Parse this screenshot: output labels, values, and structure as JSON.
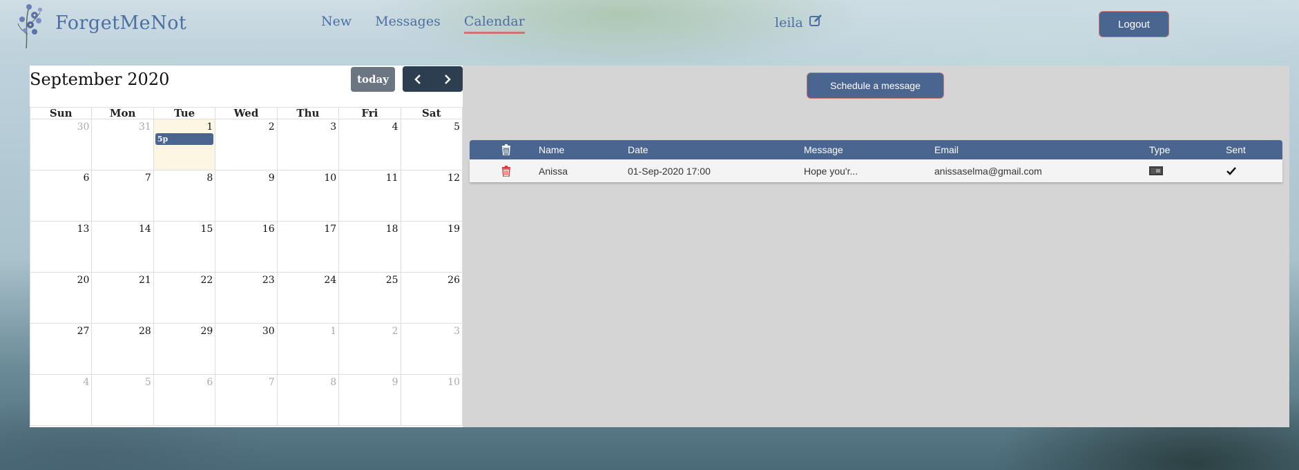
{
  "header": {
    "logo_text": "ForgetMeNot",
    "nav": [
      {
        "label": "New"
      },
      {
        "label": "Messages"
      },
      {
        "label": "Calendar"
      }
    ],
    "user_name": "leila",
    "logout_label": "Logout"
  },
  "calendar": {
    "title": "September 2020",
    "today_label": "today",
    "weekdays": [
      "Sun",
      "Mon",
      "Tue",
      "Wed",
      "Thu",
      "Fri",
      "Sat"
    ],
    "days": [
      "30",
      "31",
      "1",
      "2",
      "3",
      "4",
      "5",
      "6",
      "7",
      "8",
      "9",
      "10",
      "11",
      "12",
      "13",
      "14",
      "15",
      "16",
      "17",
      "18",
      "19",
      "20",
      "21",
      "22",
      "23",
      "24",
      "25",
      "26",
      "27",
      "28",
      "29",
      "30",
      "1",
      "2",
      "3",
      "4",
      "5",
      "6",
      "7",
      "8",
      "9",
      "10"
    ],
    "event_label": "5p"
  },
  "schedule": {
    "button_label": "Schedule a message"
  },
  "table": {
    "headers": {
      "name": "Name",
      "date": "Date",
      "message": "Message",
      "email": "Email",
      "type": "Type",
      "sent": "Sent"
    },
    "rows": [
      {
        "name": "Anissa",
        "date": "01-Sep-2020 17:00",
        "message": "Hope you'r...",
        "email": "anissaselma@gmail.com"
      }
    ]
  },
  "colors": {
    "primary": "#4a6590",
    "accent": "#c8786b",
    "delete_icon": "#e03a3a"
  },
  "icons": [
    "flower-logo-icon",
    "edit-icon",
    "chevron-left-icon",
    "chevron-right-icon",
    "trash-icon",
    "type-icon",
    "checkmark-icon"
  ]
}
